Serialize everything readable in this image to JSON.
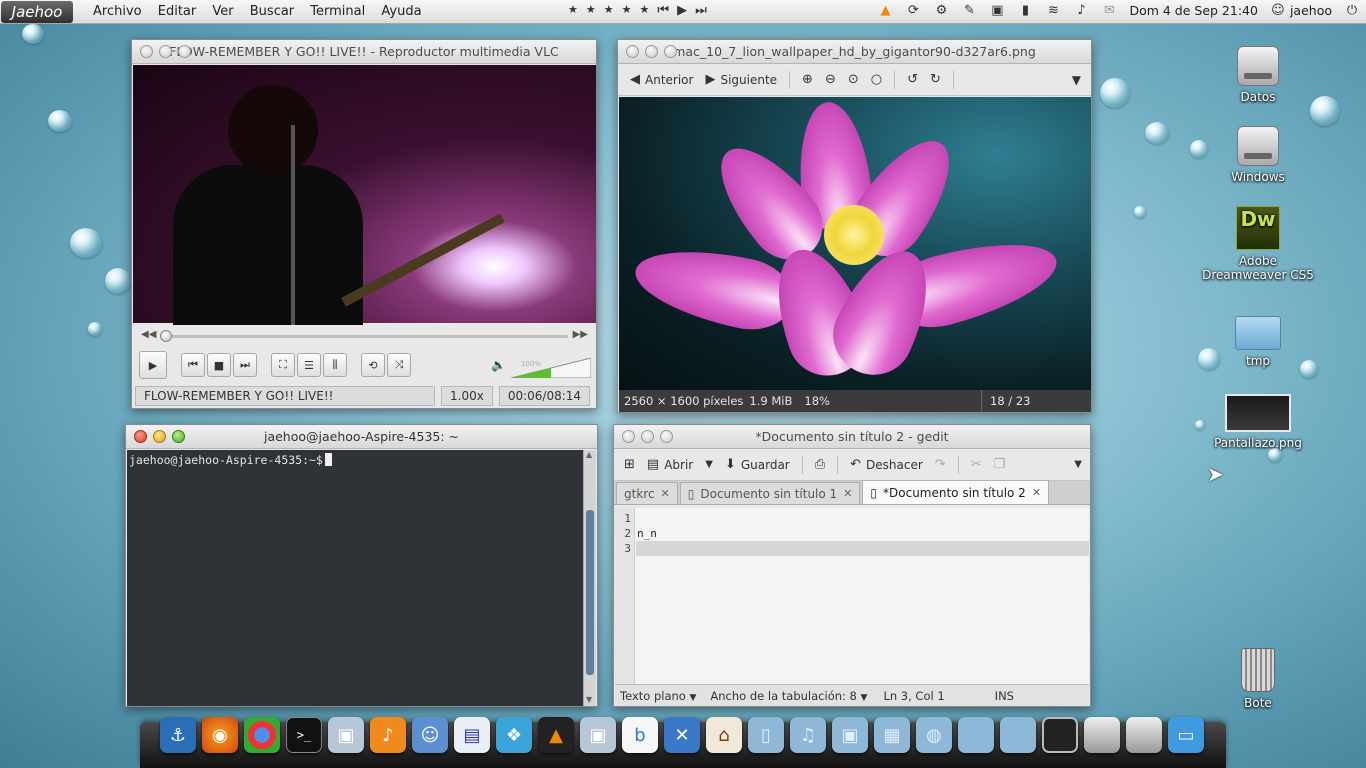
{
  "panel": {
    "logo": "Jaehoo",
    "menus": [
      "Archivo",
      "Editar",
      "Ver",
      "Buscar",
      "Terminal",
      "Ayuda"
    ],
    "media_controls": [
      "star-icon",
      "star-icon",
      "star-icon",
      "star-icon",
      "star-icon",
      "previous-icon",
      "play-icon",
      "next-icon"
    ],
    "clock": "Dom  4 de Sep 21:40",
    "user": "jaehoo"
  },
  "vlc": {
    "title": "FLOW-REMEMBER Y GO!! LIVE!! - Reproductor multimedia VLC",
    "status_title": "FLOW-REMEMBER Y GO!! LIVE!!",
    "speed": "1.00x",
    "time": "00:06/08:14",
    "progress": 0.012,
    "volume_label": "100%",
    "volume": 1.0
  },
  "eog": {
    "title": "mac_10_7_lion_wallpaper_hd_by_gigantor90-d327ar6.png",
    "prev_label": "Anterior",
    "next_label": "Siguiente",
    "dimensions": "2560 × 1600 píxeles",
    "size": "1.9 MiB",
    "zoom": "18%",
    "position": "18 / 23"
  },
  "terminal": {
    "title": "jaehoo@jaehoo-Aspire-4535: ~",
    "prompt": "jaehoo@jaehoo-Aspire-4535:~$"
  },
  "gedit": {
    "title": "*Documento sin título 2 - gedit",
    "toolbar": {
      "open": "Abrir",
      "save": "Guardar",
      "undo": "Deshacer"
    },
    "tabs": [
      {
        "label": "gtkrc",
        "active": false
      },
      {
        "label": "Documento sin título 1",
        "active": false
      },
      {
        "label": "*Documento sin título 2",
        "active": true
      }
    ],
    "lines": [
      "",
      "n_n",
      ""
    ],
    "line_numbers": [
      "1",
      "2",
      "3"
    ],
    "status": {
      "mode": "Texto plano",
      "tab_width": "Ancho de la tabulación:  8",
      "position": "Ln 3, Col 1",
      "insert": "INS"
    }
  },
  "desktop": {
    "icons": [
      "Datos",
      "Windows",
      "Adobe Dreamweaver CS5",
      "tmp",
      "Pantallazo.png",
      "Bote"
    ]
  },
  "dock": {
    "items": [
      "anchor-icon",
      "firefox-icon",
      "chrome-icon",
      "terminal-icon",
      "photo-icon",
      "music-icon",
      "finder-icon",
      "document-icon",
      "app-icon",
      "vlc-icon",
      "photo-icon",
      "bittorrent-icon",
      "xcode-icon",
      "home-icon",
      "folder-icon",
      "folder-icon",
      "folder-icon",
      "folder-icon",
      "folder-icon",
      "folder-icon",
      "folder-icon",
      "monitor-icon",
      "drive-icon",
      "drive-icon",
      "window-icon"
    ]
  }
}
